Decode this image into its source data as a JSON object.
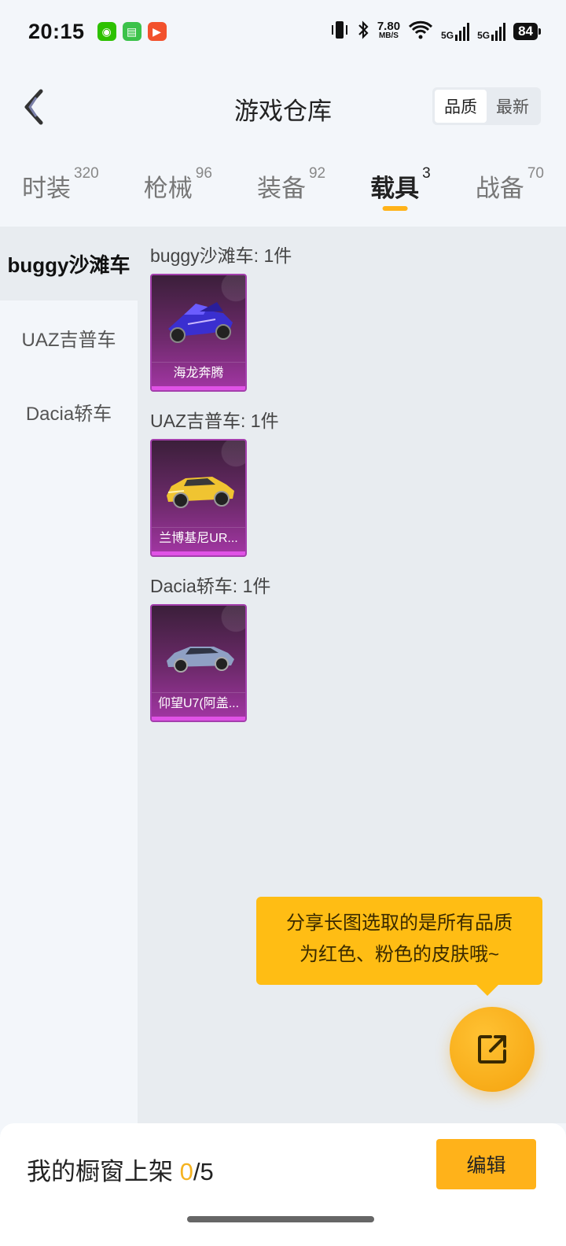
{
  "status_bar": {
    "time": "20:15",
    "net_speed": "7.80",
    "net_unit": "MB/S",
    "signal1": "5G",
    "signal2": "5G",
    "battery": "84",
    "apps": [
      "wechat-icon",
      "messages-icon",
      "video-icon"
    ]
  },
  "header": {
    "title": "游戏仓库",
    "sort_options": [
      "品质",
      "最新"
    ],
    "sort_active": "品质"
  },
  "tabs": [
    {
      "label": "时装",
      "count": "320",
      "active": false
    },
    {
      "label": "枪械",
      "count": "96",
      "active": false
    },
    {
      "label": "装备",
      "count": "92",
      "active": false
    },
    {
      "label": "载具",
      "count": "3",
      "active": true
    },
    {
      "label": "战备",
      "count": "70",
      "active": false
    }
  ],
  "sidenav": [
    {
      "label": "buggy沙滩车",
      "active": true
    },
    {
      "label": "UAZ吉普车",
      "active": false
    },
    {
      "label": "Dacia轿车",
      "active": false
    }
  ],
  "groups": [
    {
      "title": "buggy沙滩车: 1件",
      "items": [
        {
          "name": "海龙奔腾",
          "icon": "buggy-icon"
        }
      ]
    },
    {
      "title": "UAZ吉普车: 1件",
      "items": [
        {
          "name": "兰博基尼UR...",
          "icon": "suv-icon"
        }
      ]
    },
    {
      "title": "Dacia轿车: 1件",
      "items": [
        {
          "name": "仰望U7(阿盖...",
          "icon": "sedan-icon"
        }
      ]
    }
  ],
  "tooltip": {
    "line1": "分享长图选取的是所有品质",
    "line2": "为红色、粉色的皮肤哦~"
  },
  "bottom": {
    "window_label": "我的橱窗上架 ",
    "current": "0",
    "separator_total": "/5",
    "edit_label": "编辑"
  },
  "colors": {
    "accent": "#ffb21a",
    "tooltip": "#ffbd14",
    "card_border": "#a43fad",
    "count_highlight": "#f5b320"
  }
}
